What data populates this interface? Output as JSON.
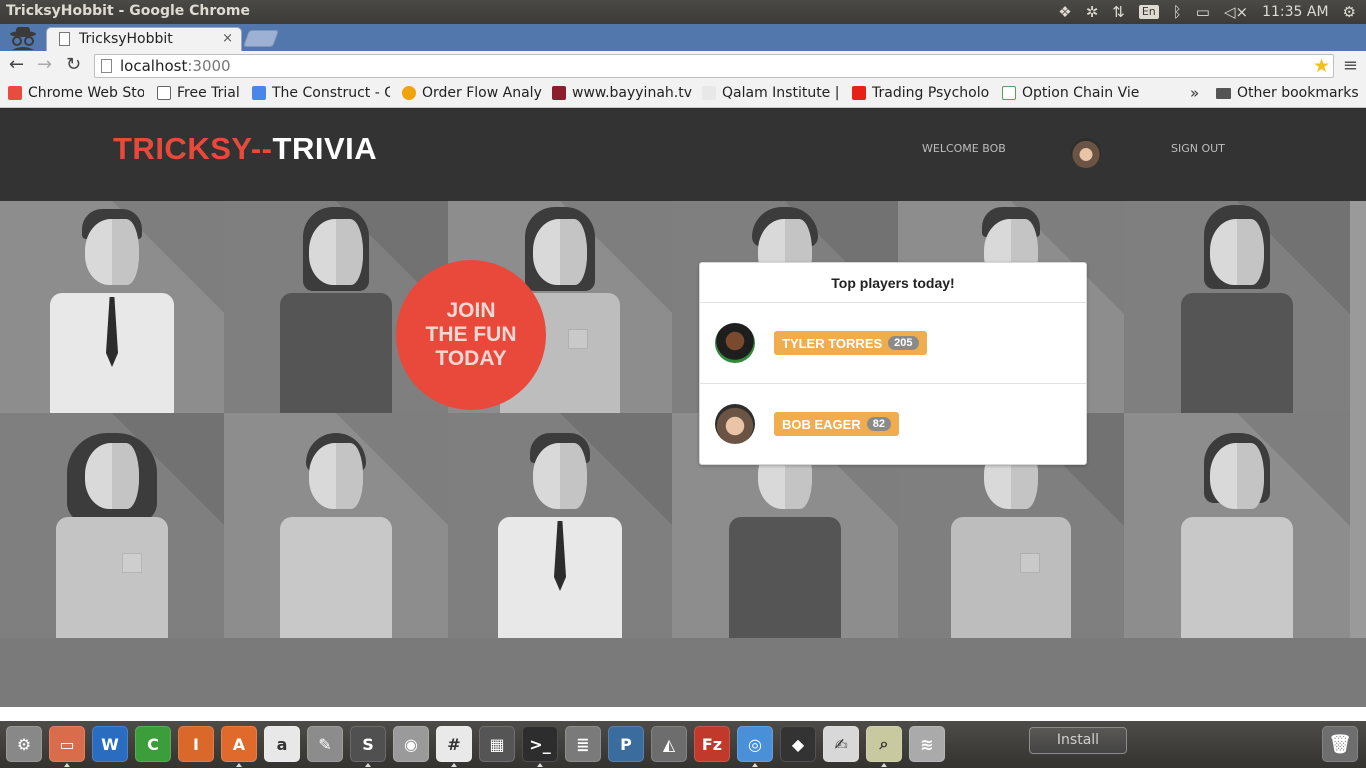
{
  "os_panel": {
    "window_title": "TricksyHobbit - Google Chrome",
    "clock": "11:35 AM",
    "keyboard_layout": "En"
  },
  "browser": {
    "tab_title": "TricksyHobbit",
    "tab_close": "×",
    "url_host": "localhost",
    "url_port": ":3000",
    "bookmarks": [
      {
        "label": "Chrome Web Sto",
        "icon": "chrome-web-store-icon",
        "color": "#e74c3c"
      },
      {
        "label": "Free Trial",
        "icon": "r-logo-icon",
        "color": "#666666"
      },
      {
        "label": "The Construct - G",
        "icon": "google-docs-icon",
        "color": "#4a86e8"
      },
      {
        "label": "Order Flow Analy",
        "icon": "orange-circle-icon",
        "color": "#f0a30a"
      },
      {
        "label": "www.bayyinah.tv",
        "icon": "bayyinah-icon",
        "color": "#8b1e2d"
      },
      {
        "label": "Qalam Institute |",
        "icon": "qalam-icon",
        "color": "#bbbbbb"
      },
      {
        "label": "Trading Psycholo",
        "icon": "youtube-icon",
        "color": "#e62117"
      },
      {
        "label": "Option Chain Vie",
        "icon": "checkmark-icon",
        "color": "#5aa05a"
      }
    ],
    "bookmarks_overflow": "»",
    "other_bookmarks": "Other bookmarks"
  },
  "site": {
    "logo_part1": "TRICKSY",
    "logo_sep": "--",
    "logo_part2": "TRIVIA",
    "welcome": "WELCOME BOB",
    "sign_out": "SIGN OUT",
    "join_line1": "JOIN",
    "join_line2": "THE FUN",
    "join_line3": "TODAY",
    "players_title": "Top players today!",
    "players": [
      {
        "name": "TYLER TORRES",
        "score": "205"
      },
      {
        "name": "BOB EAGER",
        "score": "82"
      }
    ],
    "accent_red": "#e8493b",
    "badge_orange": "#f0ad4e"
  },
  "dock": {
    "install_label": "Install",
    "apps": [
      {
        "name": "system-settings-icon",
        "color": "#888888",
        "glyph": "⚙"
      },
      {
        "name": "files-icon",
        "color": "#d96c4a",
        "glyph": "▭"
      },
      {
        "name": "writer-icon",
        "color": "#2a6cbf",
        "glyph": "W"
      },
      {
        "name": "calc-icon",
        "color": "#3b9e3b",
        "glyph": "C"
      },
      {
        "name": "impress-icon",
        "color": "#d9682a",
        "glyph": "I"
      },
      {
        "name": "software-center-icon",
        "color": "#e06a2b",
        "glyph": "A"
      },
      {
        "name": "amazon-icon",
        "color": "#e8e8e8",
        "glyph": "a"
      },
      {
        "name": "tools-icon",
        "color": "#8c8c8c",
        "glyph": "✎"
      },
      {
        "name": "sublime-icon",
        "color": "#505050",
        "glyph": "S"
      },
      {
        "name": "disk-icon",
        "color": "#9a9a9a",
        "glyph": "◉"
      },
      {
        "name": "slack-icon",
        "color": "#e9e9e9",
        "glyph": "#"
      },
      {
        "name": "workspaces-icon",
        "color": "#555555",
        "glyph": "▦"
      },
      {
        "name": "terminal-icon",
        "color": "#2d2d2d",
        "glyph": ">_"
      },
      {
        "name": "database-icon",
        "color": "#7a7a7a",
        "glyph": "≣"
      },
      {
        "name": "postgres-icon",
        "color": "#3b6c9e",
        "glyph": "P"
      },
      {
        "name": "compass-icon",
        "color": "#6d6d6d",
        "glyph": "◭"
      },
      {
        "name": "filezilla-icon",
        "color": "#c0392b",
        "glyph": "Fz"
      },
      {
        "name": "chrome-icon",
        "color": "#4a90d9",
        "glyph": "◎"
      },
      {
        "name": "inkscape-icon",
        "color": "#333333",
        "glyph": "◆"
      },
      {
        "name": "text-editor-icon",
        "color": "#d8d8d8",
        "glyph": "✍"
      },
      {
        "name": "image-viewer-icon",
        "color": "#c9c9a0",
        "glyph": "⌕"
      },
      {
        "name": "network-icon",
        "color": "#aaaaaa",
        "glyph": "≋"
      }
    ],
    "trash": "trash-icon"
  }
}
